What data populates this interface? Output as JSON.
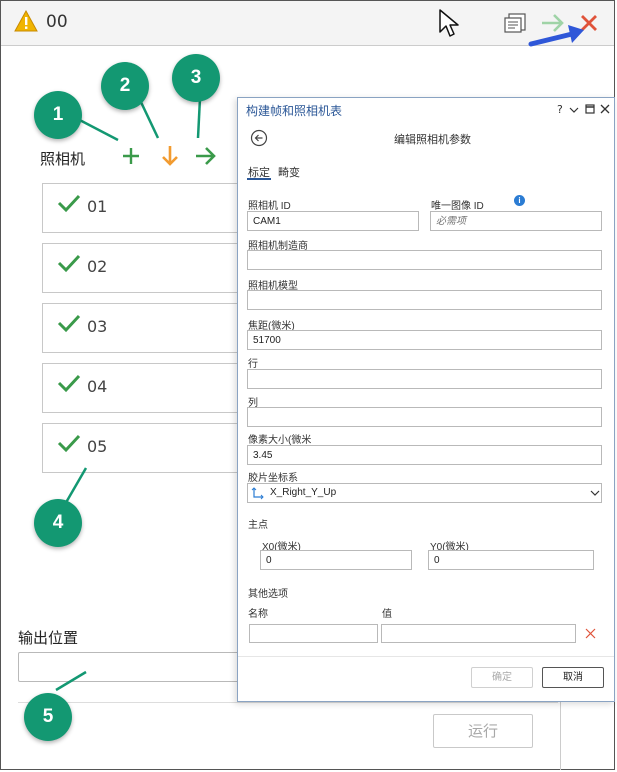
{
  "toolbar": {
    "title": "00"
  },
  "main": {
    "camera_label": "照相机",
    "cameras": [
      "01",
      "02",
      "03",
      "04",
      "05"
    ],
    "output_label": "输出位置",
    "run_button": "运行"
  },
  "callouts": [
    "1",
    "2",
    "3",
    "4",
    "5"
  ],
  "dialog": {
    "title": "构建帧和照相机表",
    "title_controls": "?",
    "subtitle": "编辑照相机参数",
    "tabs": [
      "标定",
      "畸变"
    ],
    "fields": {
      "camera_id": {
        "label": "照相机 ID",
        "value": "CAM1"
      },
      "unique_image_id": {
        "label": "唯一图像 ID",
        "placeholder": "必需项"
      },
      "manufacturer": {
        "label": "照相机制造商",
        "value": ""
      },
      "model": {
        "label": "照相机模型",
        "value": ""
      },
      "focal_length": {
        "label": "焦距(微米)",
        "value": "51700"
      },
      "rows": {
        "label": "行",
        "value": ""
      },
      "columns": {
        "label": "列",
        "value": ""
      },
      "pixel_size": {
        "label": "像素大小(微米",
        "value": "3.45"
      },
      "film_coord": {
        "label": "胶片坐标系",
        "value": "X_Right_Y_Up"
      }
    },
    "principal_point": {
      "label": "主点",
      "x0": {
        "label": "X0(微米)",
        "value": "0"
      },
      "y0": {
        "label": "Y0(微米)",
        "value": "0"
      }
    },
    "other_options": {
      "label": "其他选项",
      "col_name": "名称",
      "col_value": "值"
    },
    "ok_button": "确定",
    "cancel_button": "取消"
  },
  "colors": {
    "accent_green": "#139872",
    "check_green": "#3a9a4a",
    "arrow_orange": "#f29b30",
    "close_red": "#e0533a",
    "pointer_blue": "#2f57d8"
  }
}
